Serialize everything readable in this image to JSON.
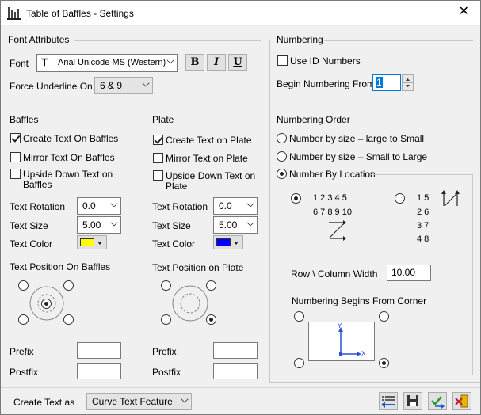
{
  "window": {
    "title": "Table of Baffles - Settings",
    "close_glyph": "✕"
  },
  "font_attributes": {
    "header": "Font Attributes",
    "font_label": "Font",
    "font_value": "Arial Unicode MS (Western)",
    "bold": "B",
    "italic": "I",
    "underline": "U",
    "force_underline_label": "Force Underline On",
    "force_underline_value": "6 & 9"
  },
  "baffles": {
    "header": "Baffles",
    "create_text": "Create Text On Baffles",
    "mirror_text": "Mirror Text On Baffles",
    "upside_down_line1": "Upside Down Text on",
    "upside_down_line2": "Baffles",
    "rotation_label": "Text Rotation",
    "rotation_value": "0.0",
    "size_label": "Text Size",
    "size_value": "5.00",
    "color_label": "Text Color",
    "color": "#ffff00",
    "position_label": "Text Position On Baffles",
    "prefix_label": "Prefix",
    "postfix_label": "Postfix"
  },
  "plate": {
    "header": "Plate",
    "create_text": "Create Text on Plate",
    "mirror_text": "Mirror Text on Plate",
    "upside_down_line1": "Upside Down Text on",
    "upside_down_line2": "Plate",
    "rotation_label": "Text Rotation",
    "rotation_value": "0.0",
    "size_label": "Text Size",
    "size_value": "5.00",
    "color_label": "Text Color",
    "color": "#0000ff",
    "position_label": "Text Position on Plate",
    "prefix_label": "Prefix",
    "postfix_label": "Postfix"
  },
  "numbering": {
    "header": "Numbering",
    "use_id": "Use ID Numbers",
    "begin_label": "Begin Numbering From",
    "begin_value": "1",
    "order_header": "Numbering Order",
    "opt_large_small": "Number by size – large to Small",
    "opt_small_large": "Number by size – Small to Large",
    "opt_location": "Number By Location",
    "row_pattern_line1": "1 2 3 4 5",
    "row_pattern_line2": "6 7 8 9 10",
    "col_pattern": [
      "1  5",
      "2  6",
      "3  7",
      "4  8"
    ],
    "row_col_label": "Row \\ Column Width",
    "row_col_value": "10.00",
    "corner_label": "Numbering Begins From Corner",
    "axis_x": "X",
    "axis_y": "Y"
  },
  "footer": {
    "create_text_as_label": "Create Text as",
    "create_text_as_value": "Curve Text Feature"
  }
}
